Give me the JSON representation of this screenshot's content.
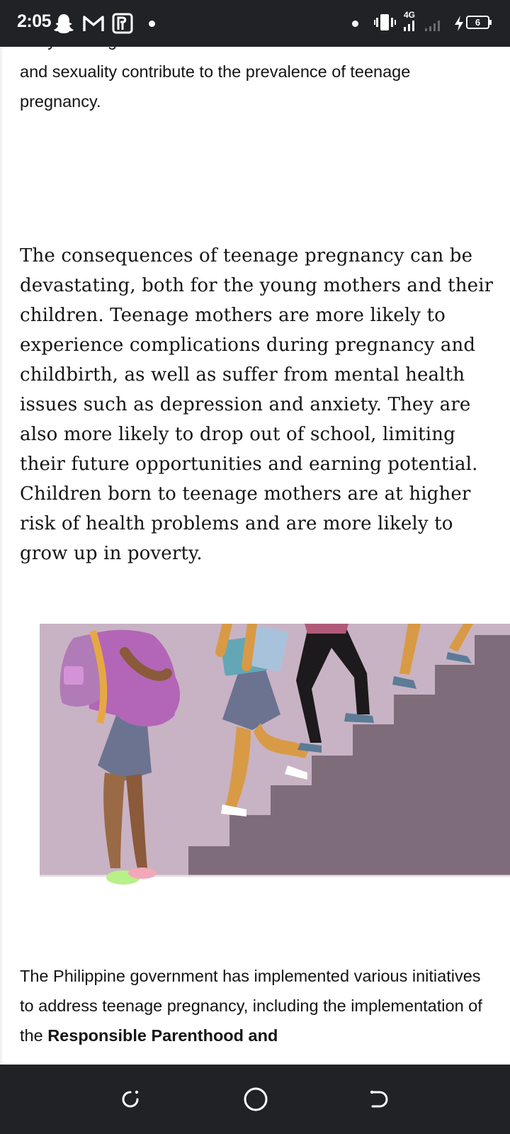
{
  "status_bar": {
    "time": "2:05",
    "network": "4G",
    "battery": "6"
  },
  "article": {
    "intro_fragment_cut": "early marriage and conservative attitudes towards sex",
    "intro_fragment_rest": "and sexuality contribute to the prevalence of teenage pregnancy.",
    "consequences_paragraph": "The consequences of teenage pregnancy can be devastating, both for the young mothers and their children. Teenage mothers are more likely to experience complications during pregnancy and childbirth, as well as suffer from mental health issues such as depression and anxiety. They are also more likely to drop out of school, limiting their future opportunities and earning potential. Children born to teenage mothers are at higher risk of health problems and are more likely to grow up in poverty.",
    "government_paragraph_start": "The Philippine government has implemented various initiatives to address teenage pregnancy, including the implementation of the ",
    "government_paragraph_bold": "Responsible Parenthood and"
  },
  "icons": [
    "snapchat-icon",
    "gmail-icon",
    "paypal-icon",
    "vibrate-icon",
    "signal-icon",
    "battery-icon",
    "recents-icon",
    "home-icon",
    "back-icon"
  ],
  "colors": {
    "bar_background": "#212225",
    "illustration_wall": "#c8b3c4",
    "illustration_stairs": "#7e6c7b"
  }
}
